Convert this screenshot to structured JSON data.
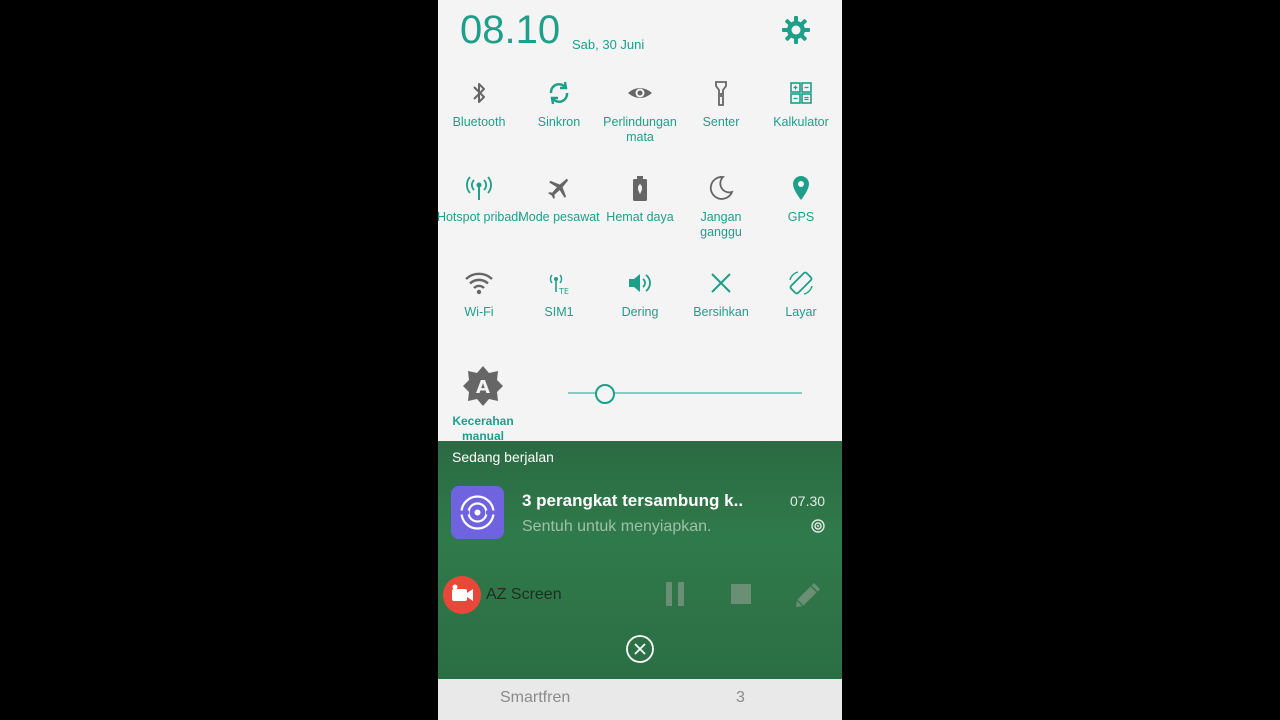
{
  "header": {
    "time": "08.10",
    "date": "Sab, 30 Juni"
  },
  "tiles": [
    {
      "label": "Bluetooth",
      "icon": "bluetooth-icon"
    },
    {
      "label": "Sinkron",
      "icon": "sync-icon"
    },
    {
      "label": "Perlindungan mata",
      "icon": "eye-icon"
    },
    {
      "label": "Senter",
      "icon": "flashlight-icon"
    },
    {
      "label": "Kalkulator",
      "icon": "calculator-icon"
    },
    {
      "label": "Hotspot pribadi",
      "icon": "hotspot-icon"
    },
    {
      "label": "Mode pesawat",
      "icon": "airplane-icon"
    },
    {
      "label": "Hemat daya",
      "icon": "battery-saver-icon"
    },
    {
      "label": "Jangan ganggu",
      "icon": "moon-icon"
    },
    {
      "label": "GPS",
      "icon": "location-pin-icon"
    },
    {
      "label": "Wi-Fi",
      "icon": "wifi-icon"
    },
    {
      "label": "SIM1",
      "icon": "lte-signal-icon"
    },
    {
      "label": "Dering",
      "icon": "speaker-icon"
    },
    {
      "label": "Bersihkan",
      "icon": "close-x-icon"
    },
    {
      "label": "Layar",
      "icon": "screen-rotate-icon"
    }
  ],
  "brightness": {
    "label": "Kecerahan manual",
    "level_fraction": 0.16,
    "icon_letter": "A"
  },
  "notifications": {
    "section_title": "Sedang berjalan",
    "item": {
      "title": "3 perangkat tersambung k..",
      "subtitle": "Sentuh untuk menyiapkan.",
      "time": "07.30"
    },
    "recorder": {
      "app_name": "AZ Screen"
    }
  },
  "carrier": {
    "name": "Smartfren",
    "count": "3"
  },
  "colors": {
    "accent": "#1e9f8a",
    "tile_gray": "#666666",
    "notif_bg": "#2f7a4a",
    "app_purple": "#6f63e0",
    "recorder_red": "#e8483a"
  }
}
